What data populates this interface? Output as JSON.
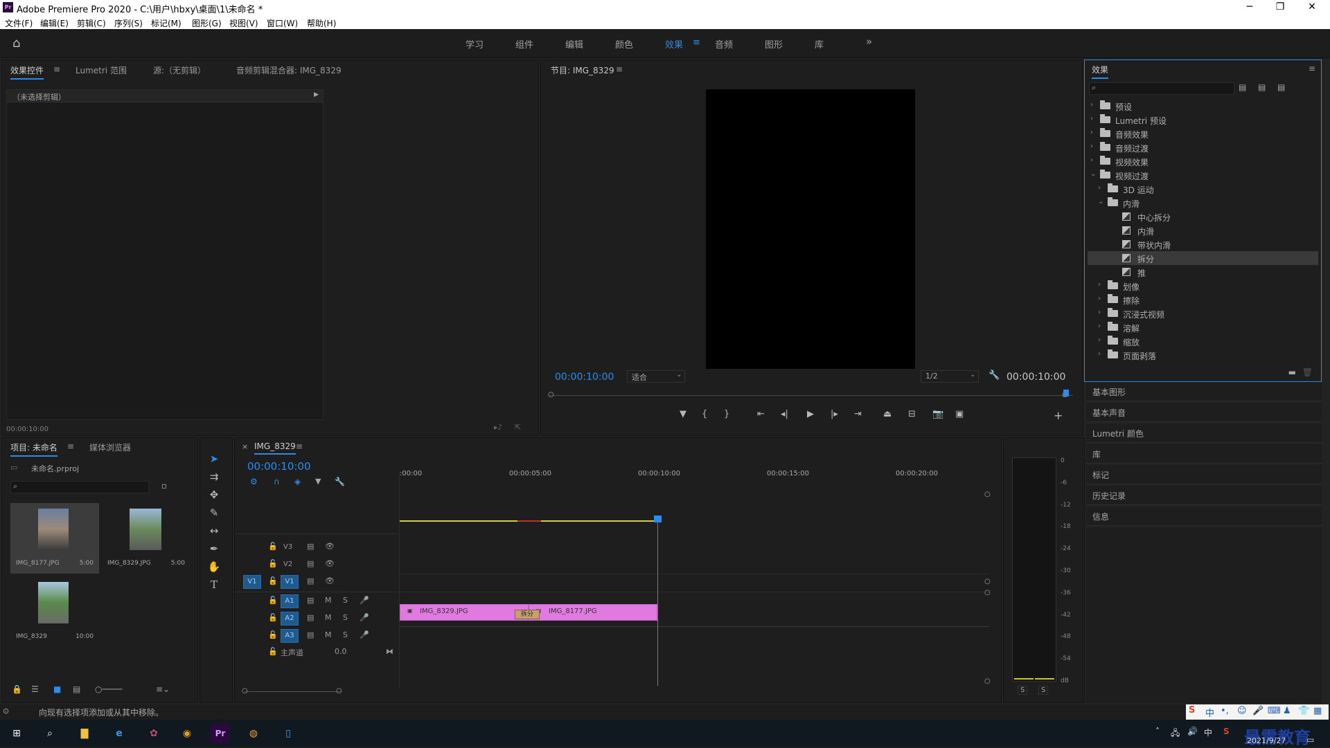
{
  "window": {
    "title": "Adobe Premiere Pro 2020 - C:\\用户\\hbxy\\桌面\\1\\未命名 *",
    "logo": "Pr"
  },
  "menu": [
    "文件(F)",
    "编辑(E)",
    "剪辑(C)",
    "序列(S)",
    "标记(M)",
    "图形(G)",
    "视图(V)",
    "窗口(W)",
    "帮助(H)"
  ],
  "workspaces": {
    "items": [
      "学习",
      "组件",
      "编辑",
      "颜色",
      "效果",
      "音频",
      "图形",
      "库"
    ],
    "active": "效果",
    "more": "»"
  },
  "effect_controls": {
    "tabs": [
      "效果控件",
      "Lumetri 范围",
      "源:（无剪辑）",
      "音频剪辑混合器: IMG_8329"
    ],
    "no_clip": "（未选择剪辑）",
    "timecode": "00:00:10:00"
  },
  "program": {
    "title": "节目: IMG_8329",
    "timecode": "00:00:10:00",
    "fit": "适合",
    "resolution": "1/2",
    "duration": "00:00:10:00"
  },
  "effects": {
    "title": "效果",
    "tree": [
      {
        "label": "预设",
        "level": 0,
        "type": "folder",
        "chev": "›"
      },
      {
        "label": "Lumetri 预设",
        "level": 0,
        "type": "folder",
        "chev": "›"
      },
      {
        "label": "音频效果",
        "level": 0,
        "type": "folder",
        "chev": "›"
      },
      {
        "label": "音频过渡",
        "level": 0,
        "type": "folder",
        "chev": "›"
      },
      {
        "label": "视频效果",
        "level": 0,
        "type": "folder",
        "chev": "›"
      },
      {
        "label": "视频过渡",
        "level": 0,
        "type": "folder",
        "chev": "⌄"
      },
      {
        "label": "3D 运动",
        "level": 1,
        "type": "folder",
        "chev": "›"
      },
      {
        "label": "内滑",
        "level": 1,
        "type": "folder",
        "chev": "⌄"
      },
      {
        "label": "中心拆分",
        "level": 2,
        "type": "fx"
      },
      {
        "label": "内滑",
        "level": 2,
        "type": "fx"
      },
      {
        "label": "带状内滑",
        "level": 2,
        "type": "fx"
      },
      {
        "label": "拆分",
        "level": 2,
        "type": "fx",
        "selected": true
      },
      {
        "label": "推",
        "level": 2,
        "type": "fx"
      },
      {
        "label": "划像",
        "level": 1,
        "type": "folder",
        "chev": "›"
      },
      {
        "label": "擦除",
        "level": 1,
        "type": "folder",
        "chev": "›"
      },
      {
        "label": "沉浸式视频",
        "level": 1,
        "type": "folder",
        "chev": "›"
      },
      {
        "label": "溶解",
        "level": 1,
        "type": "folder",
        "chev": "›"
      },
      {
        "label": "缩放",
        "level": 1,
        "type": "folder",
        "chev": "›"
      },
      {
        "label": "页面剥落",
        "level": 1,
        "type": "folder",
        "chev": "›"
      }
    ]
  },
  "side_panels": [
    "基本图形",
    "基本声音",
    "Lumetri 颜色",
    "库",
    "标记",
    "历史记录",
    "信息"
  ],
  "project": {
    "tabs": [
      "项目: 未命名",
      "媒体浏览器"
    ],
    "file": "未命名.prproj",
    "items": [
      {
        "name": "IMG_8177.JPG",
        "dur": "5:00"
      },
      {
        "name": "IMG_8329.JPG",
        "dur": "5:00"
      },
      {
        "name": "IMG_8329",
        "dur": "10:00"
      }
    ]
  },
  "timeline": {
    "tab": "IMG_8329",
    "close": "×",
    "timecode": "00:00:10:00",
    "ruler": [
      ":00:00",
      "00:00:05:00",
      "00:00:10:00",
      "00:00:15:00",
      "00:00:20:00"
    ],
    "video_tracks": [
      "V3",
      "V2",
      "V1"
    ],
    "audio_tracks": [
      "A1",
      "A2",
      "A3"
    ],
    "source_patch": "V1",
    "master": {
      "label": "主声道",
      "value": "0.0"
    },
    "clips": [
      {
        "name": "IMG_8329.JPG"
      },
      {
        "name": "IMG_8177.JPG"
      }
    ],
    "transition": "拆分",
    "mute": "M",
    "solo": "S"
  },
  "meter": {
    "scale": [
      "0",
      "-6",
      "-12",
      "-18",
      "-24",
      "-30",
      "-36",
      "-42",
      "-48",
      "-54",
      "dB"
    ],
    "solo": [
      "S",
      "S"
    ]
  },
  "status": "向现有选择项添加或从其中移除。",
  "taskbar": {
    "date": "2021/9/27",
    "watermark": "最需教育"
  }
}
